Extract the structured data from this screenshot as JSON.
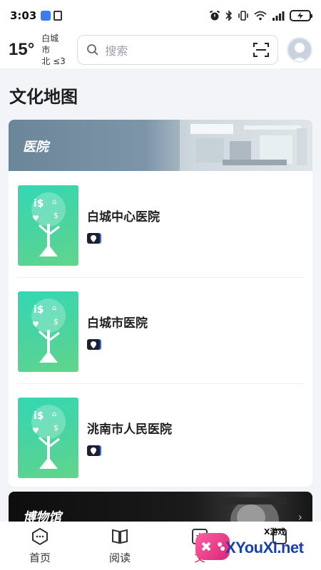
{
  "status_bar": {
    "time": "3:03",
    "icons": [
      "app-notification-icon",
      "nfc-icon",
      "alarm-icon",
      "bluetooth-icon",
      "vibrate-icon",
      "wifi-icon",
      "signal-icon",
      "battery-charging-icon"
    ]
  },
  "header": {
    "temperature": "15°",
    "city": "白城市",
    "wind": "北 ≤3",
    "search_placeholder": "搜索",
    "scan_icon": "scan-icon",
    "avatar_icon": "user-avatar-icon"
  },
  "page": {
    "title": "文化地图"
  },
  "section": {
    "category": "医院",
    "items": [
      {
        "name": "白城中心医院",
        "badge_icon": "location-pin-icon"
      },
      {
        "name": "白城市医院",
        "badge_icon": "location-pin-icon"
      },
      {
        "name": "洮南市人民医院",
        "badge_icon": "location-pin-icon"
      }
    ]
  },
  "next_section": {
    "category": "博物馆",
    "arrow": "›"
  },
  "bottom_nav": {
    "items": [
      {
        "label": "首页",
        "icon": "home-icon"
      },
      {
        "label": "阅读",
        "icon": "book-icon"
      },
      {
        "label": "文",
        "icon": "culture-icon",
        "active": true
      },
      {
        "label": "",
        "icon": "mine-icon"
      }
    ]
  },
  "watermark": {
    "small": "X游戏",
    "main": "XYouXi.net"
  },
  "colors": {
    "accent": "#c8283c",
    "thumb_green": "#49d4a0",
    "badge_dark": "#1d2030"
  }
}
